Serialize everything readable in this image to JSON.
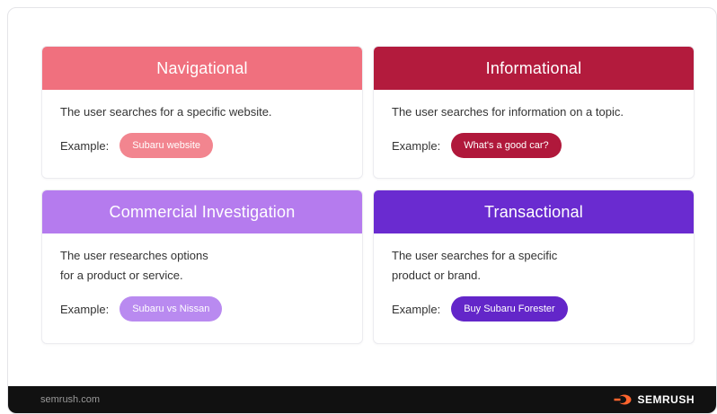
{
  "cards": [
    {
      "title": "Navigational",
      "header_color": "#f0707e",
      "description": [
        "The user searches for a specific website."
      ],
      "example_label": "Example:",
      "example": "Subaru website",
      "pill_color": "#f2858f"
    },
    {
      "title": "Informational",
      "header_color": "#b31b3d",
      "description": [
        "The user searches for information on a topic."
      ],
      "example_label": "Example:",
      "example": "What's a good car?",
      "pill_color": "#b0183b"
    },
    {
      "title": "Commercial Investigation",
      "header_color": "#b57bee",
      "description": [
        "The user researches options",
        "for a product or service."
      ],
      "example_label": "Example:",
      "example": "Subaru vs Nissan",
      "pill_color": "#b98af0"
    },
    {
      "title": "Transactional",
      "header_color": "#6a2bd0",
      "description": [
        "The user searches for a specific",
        "product or brand."
      ],
      "example_label": "Example:",
      "example": "Buy Subaru Forester",
      "pill_color": "#6326c9"
    }
  ],
  "footer": {
    "url": "semrush.com",
    "brand": "SEMRUSH",
    "brand_color": "#ff642d"
  }
}
